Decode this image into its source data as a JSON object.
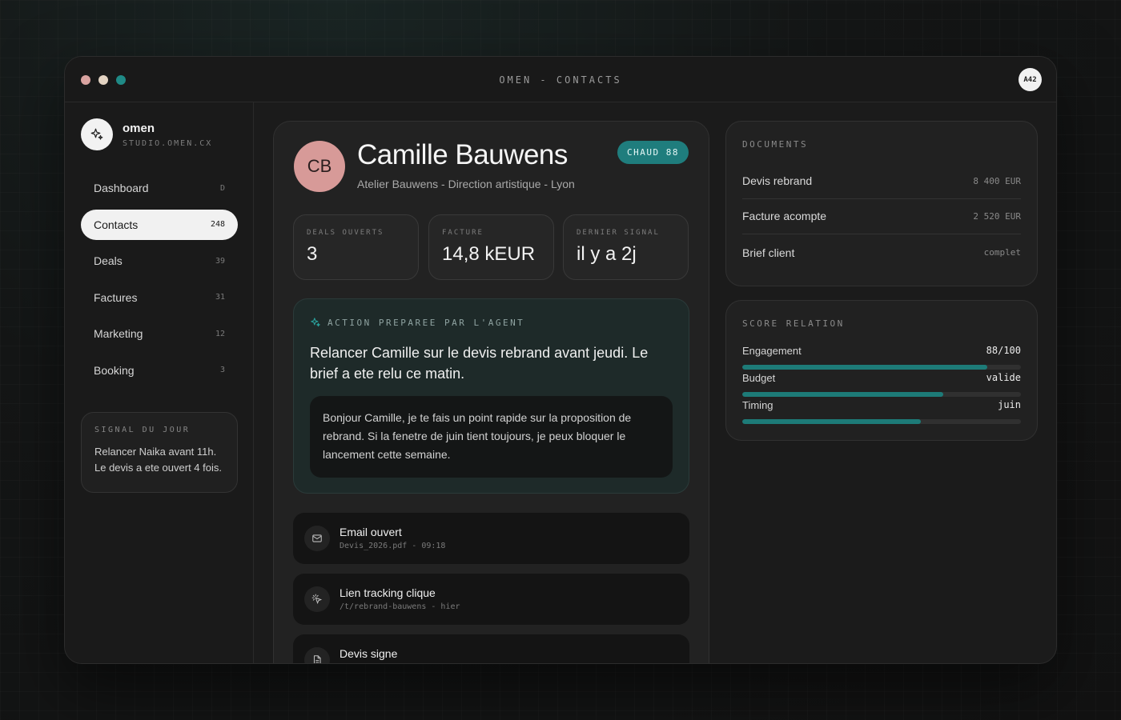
{
  "window": {
    "title": "OMEN - CONTACTS",
    "user_initials": "A42",
    "traffic_colors": [
      "#d9a3a0",
      "#e3d3c2",
      "#1f8a86"
    ]
  },
  "sidebar": {
    "brand_name": "omen",
    "brand_sub": "STUDIO.OMEN.CX",
    "items": [
      {
        "label": "Dashboard",
        "count": "D",
        "active": false
      },
      {
        "label": "Contacts",
        "count": "248",
        "active": true
      },
      {
        "label": "Deals",
        "count": "39",
        "active": false
      },
      {
        "label": "Factures",
        "count": "31",
        "active": false
      },
      {
        "label": "Marketing",
        "count": "12",
        "active": false
      },
      {
        "label": "Booking",
        "count": "3",
        "active": false
      }
    ],
    "signal": {
      "label": "SIGNAL DU JOUR",
      "text": "Relancer Naika avant 11h. Le devis a ete ouvert 4 fois."
    }
  },
  "contact": {
    "initials": "CB",
    "name": "Camille Bauwens",
    "subtitle": "Atelier Bauwens - Direction artistique - Lyon",
    "badge": "CHAUD 88",
    "stats": [
      {
        "label": "DEALS OUVERTS",
        "value": "3"
      },
      {
        "label": "FACTURE",
        "value": "14,8 kEUR"
      },
      {
        "label": "DERNIER SIGNAL",
        "value": "il y a 2j"
      }
    ]
  },
  "agent": {
    "label": "ACTION PREPAREE PAR L'AGENT",
    "text": "Relancer Camille sur le devis rebrand avant jeudi. Le brief a ete relu ce matin.",
    "draft": "Bonjour Camille, je te fais un point rapide sur la proposition de rebrand. Si la fenetre de juin tient toujours, je peux bloquer le lancement cette semaine."
  },
  "events": [
    {
      "title": "Email ouvert",
      "meta": "Devis_2026.pdf - 09:18",
      "icon": "mail-icon"
    },
    {
      "title": "Lien tracking clique",
      "meta": "/t/rebrand-bauwens - hier",
      "icon": "click-icon"
    },
    {
      "title": "Devis signe",
      "meta": "",
      "icon": "document-icon"
    }
  ],
  "documents": {
    "title": "DOCUMENTS",
    "rows": [
      {
        "name": "Devis rebrand",
        "value": "8 400 EUR"
      },
      {
        "name": "Facture acompte",
        "value": "2 520 EUR"
      },
      {
        "name": "Brief client",
        "value": "complet"
      }
    ]
  },
  "score": {
    "title": "SCORE RELATION",
    "rows": [
      {
        "name": "Engagement",
        "value": "88/100",
        "fill": 0.88
      },
      {
        "name": "Budget",
        "value": "valide",
        "fill": 0.72
      },
      {
        "name": "Timing",
        "value": "juin",
        "fill": 0.64
      }
    ]
  },
  "accent": "#1f7d7d"
}
